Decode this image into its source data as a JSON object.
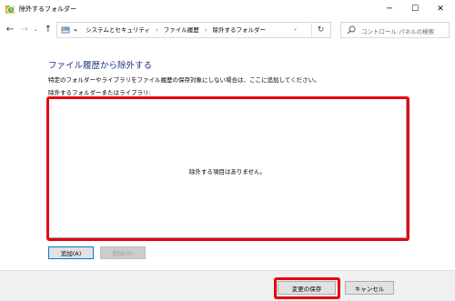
{
  "window": {
    "title": "除外するフォルダー",
    "minimize": "─",
    "maximize": "☐",
    "close": "✕"
  },
  "nav": {
    "back": "←",
    "forward": "→",
    "recent": "⌄",
    "up": "↑",
    "overflow": "«",
    "breadcrumbs": [
      "システムとセキュリティ",
      "ファイル履歴",
      "除外するフォルダー"
    ],
    "separator": "›",
    "address_dropdown": "⌄",
    "refresh": "↻"
  },
  "search": {
    "placeholder": "コントロール パネルの検索"
  },
  "content": {
    "heading": "ファイル履歴から除外する",
    "description": "特定のフォルダーやライブラリをファイル履歴の保存対象にしない場合は、ここに追加してください。",
    "list_label": "除外するフォルダーまたはライブラリ:",
    "empty_message": "除外する項目はありません。"
  },
  "buttons": {
    "add": "追加(A)",
    "remove": "削除(R)",
    "save": "変更の保存",
    "cancel": "キャンセル"
  },
  "colors": {
    "heading": "#1e3287",
    "highlight": "#e60012",
    "focus_border": "#0078d7"
  }
}
